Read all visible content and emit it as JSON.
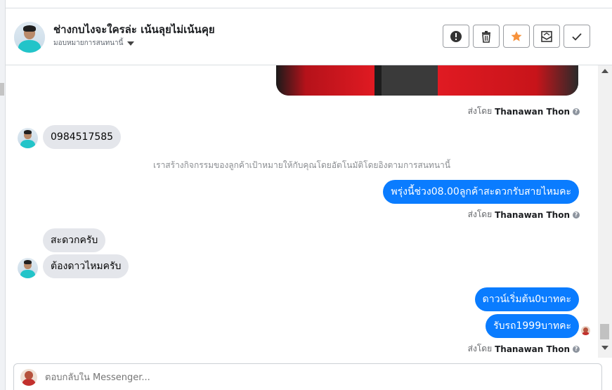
{
  "header": {
    "title": "ช่างกบไงจะใครล่ะ เน้นลุยไม่เน้นคุย",
    "assign_label": "มอบหมายการสนทนานี้",
    "actions": [
      {
        "icon": "exclamation-icon"
      },
      {
        "icon": "trash-icon"
      },
      {
        "icon": "star-icon"
      },
      {
        "icon": "mail-icon"
      },
      {
        "icon": "check-icon"
      }
    ],
    "star_color": "#f7923b"
  },
  "messages": {
    "sent_by_prefix": "ส่งโดย",
    "sender_name": "Thanawan Thon",
    "in_phone": "0984517585",
    "system_note": "เราสร้างกิจกรรมของลูกค้าเป้าหมายให้กับคุณโดยอัตโนมัติโดยอิงตามการสนทนานี้",
    "out_1": "พรุ่งนี้ช่วง08.00ลูกค้าสะดวกรับสายไหมคะ",
    "in_2": "สะดวกครับ",
    "in_3": "ต้องดาวไหมครับ",
    "out_2": "ดาวน์เริ่มต้น0บาทคะ",
    "out_3": "รับรถ1999บาทคะ"
  },
  "composer": {
    "placeholder": "ตอบกลับใน Messenger..."
  },
  "colors": {
    "outgoing_bubble": "#0a7cff",
    "incoming_bubble": "#e4e6eb"
  }
}
